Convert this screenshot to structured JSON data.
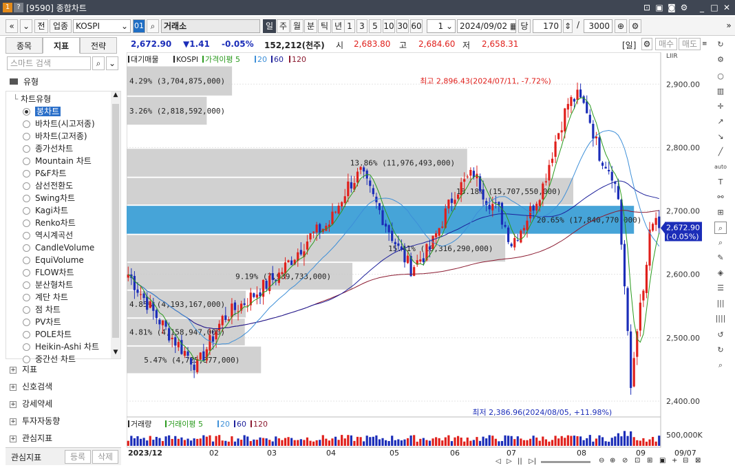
{
  "window": {
    "badge1": "1",
    "badge2": "?",
    "title": "[9590] 종합차트"
  },
  "toolbar": {
    "nav_prev": "«",
    "nav_next": "»",
    "btn_prev": "전",
    "btn_sector": "업종",
    "symbol": "KOSPI",
    "symbol_code": "01",
    "exchange": "거래소",
    "periods": [
      "일",
      "주",
      "월",
      "분",
      "틱",
      "년"
    ],
    "intervals": [
      "1",
      "3",
      "5",
      "10",
      "30",
      "60"
    ],
    "count_field": "1",
    "date": "2024/09/02",
    "unit_label": "당",
    "bars": "170",
    "slash": "/",
    "max": "3000",
    "extra": "»"
  },
  "infobar": {
    "price": "2,672.90",
    "change": "▼1.41",
    "change_pct": "-0.05%",
    "volume": "152,212(천주)",
    "open_label": "시",
    "open": "2,683.80",
    "high_label": "고",
    "high": "2,684.60",
    "low_label": "저",
    "low": "2,658.31",
    "period_tag": "[일]",
    "buy": "매수",
    "sell": "매도"
  },
  "left_panel": {
    "tabs": [
      "종목",
      "지표",
      "전략"
    ],
    "search_placeholder": "스마트 검색",
    "type_folder": "유형",
    "chart_type_label": "차트유형",
    "chart_types": [
      "봉차트",
      "바차트(시고저종)",
      "바차트(고저종)",
      "종가선차트",
      "Mountain 차트",
      "P&F차트",
      "삼선전환도",
      "Swing차트",
      "Kagi차트",
      "Renko차트",
      "역시계곡선",
      "CandleVolume",
      "EquiVolume",
      "FLOW차트",
      "분산형차트",
      "계단 차트",
      "점 차트",
      "PV차트",
      "POLE차트",
      "Heikin-Ashi 차트",
      "중간선 차트"
    ],
    "selected_type": 0,
    "sections": [
      "지표",
      "신호검색",
      "강세약세",
      "투자자동향",
      "관심지표"
    ],
    "bottom_label": "관심지표",
    "bottom_register": "등록",
    "bottom_delete": "삭제"
  },
  "chart_data": {
    "type": "candlestick",
    "legend": {
      "volume_profile": "대기매물",
      "symbol": "KOSPI",
      "ma_label": "가격이평",
      "ma_periods": [
        "5",
        "20",
        "60",
        "120"
      ]
    },
    "y_ticks": [
      2900,
      2800,
      2700,
      2600,
      2500,
      2400
    ],
    "y_range": [
      2375,
      2935
    ],
    "x_labels": [
      "2023/12",
      "02",
      "03",
      "04",
      "05",
      "06",
      "07",
      "08",
      "09"
    ],
    "x_right_label": "09/07",
    "current_price_label": "2,672.90",
    "current_change_label": "(-0.05%)",
    "current_price": 2672.9,
    "max_annotation": "최고 2,896.43(2024/07/11, -7.72%)",
    "min_annotation": "최저 2,386.96(2024/08/05, +11.98%)",
    "max_point": 2896.43,
    "min_point": 2386.96,
    "volume_profile": [
      {
        "low": 2882,
        "high": 2928,
        "pct": 4.29,
        "label": "4.29% (3,704,875,000)"
      },
      {
        "low": 2836,
        "high": 2880,
        "pct": 3.26,
        "label": "3.26% (2,818,592,000)"
      },
      {
        "low": 2754,
        "high": 2798,
        "pct": 13.86,
        "label": "13.86% (11,976,493,000)"
      },
      {
        "low": 2710,
        "high": 2752,
        "pct": 18.18,
        "label": "18.18% (15,707,550,000)"
      },
      {
        "low": 2664,
        "high": 2708,
        "pct": 20.65,
        "label": "20.65% (17,840,770,000)"
      },
      {
        "low": 2620,
        "high": 2662,
        "pct": 15.41,
        "label": "15.41% (13,316,290,000)"
      },
      {
        "low": 2576,
        "high": 2618,
        "pct": 9.19,
        "label": "9.19% (7,939,733,000)"
      },
      {
        "low": 2532,
        "high": 2574,
        "pct": 4.85,
        "label": "4.85% (4,193,167,000)"
      },
      {
        "low": 2488,
        "high": 2530,
        "pct": 4.81,
        "label": "4.81% (4,158,947,000)"
      },
      {
        "low": 2444,
        "high": 2486,
        "pct": 5.47,
        "label": "5.47% (4,725,377,000)"
      }
    ],
    "volume_legend": {
      "label": "거래량",
      "ma_label": "거래이평",
      "ma_periods": [
        "5",
        "20",
        "60",
        "120"
      ]
    },
    "volume_axis_label": "500,000K",
    "colors": {
      "up": "#e0201c",
      "down": "#1b2db8",
      "ma5": "#2a9a1d",
      "ma20": "#3d8fd8",
      "ma60": "#1c1f9a",
      "ma120": "#8b1a30",
      "profile": "#c9c9c9",
      "profile_hl": "#3c9fd6"
    }
  },
  "bottom_bar": {
    "b1": "◁",
    "b2": "▷",
    "b3": "||",
    "b4": "▷|"
  }
}
